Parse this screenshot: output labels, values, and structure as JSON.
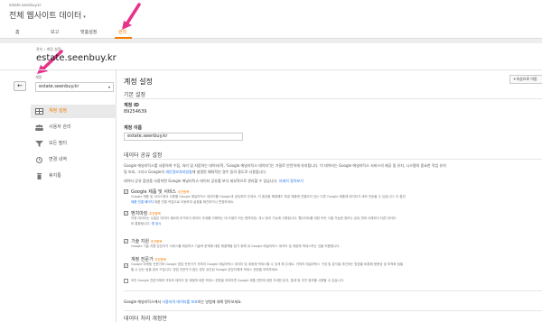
{
  "header": {
    "account_small": "estate.seenbuy.kr",
    "account_main": "전체 웹사이트 데이터",
    "tabs": [
      {
        "label": "홈"
      },
      {
        "label": "보고"
      },
      {
        "label": "맞춤설정"
      },
      {
        "label": "관리"
      }
    ],
    "active_tab": "관리"
  },
  "breadcrumb": "관리 › 계정 설정",
  "page_title": "estate.seenbuy.kr",
  "sidebar": {
    "account_label": "계정",
    "account_value": "estate.seenbuy.kr",
    "items": [
      {
        "label": "계정 설정",
        "icon": "settings-grid-icon",
        "active": true
      },
      {
        "label": "사용자 관리",
        "icon": "users-icon",
        "active": false
      },
      {
        "label": "모든 필터",
        "icon": "filter-icon",
        "active": false
      },
      {
        "label": "변경 내역",
        "icon": "history-icon",
        "active": false
      },
      {
        "label": "휴지통",
        "icon": "trash-icon",
        "active": false
      }
    ]
  },
  "main": {
    "section_title": "계정 설정",
    "property_button": "+속성으로 이동",
    "basic_settings": "기본 설정",
    "account_id_label": "계정 ID",
    "account_id_value": "89254639",
    "account_name_label": "계정 이름",
    "account_name_value": "estate.seenbuy.kr",
    "sharing_title": "데이터 공유 설정",
    "sharing_para1": "Google 애널리틱스를 사용하여 수집, 처리 및 저장하는 데이터(즉, 'Google 애널리틱스 데이터')는 기밀로 안전하게 유지됩니다. 이 데이터는 Google 애널리틱스 서비스의 제공 및 유지, 시스템의 중요한 작업 유지",
    "sharing_para1b": "및 보호, 그리고 Google의",
    "sharing_para1_link": "개인정보처리방침",
    "sharing_para1c": "에 설명된 예외적인 경우 등의 용도로 사용됩니다.",
    "sharing_para2": "데이터 공유 옵션을 사용하면 Google 애널리틱스 데이터 공유를 보다 세부적으로 관리할 수 있습니다.",
    "sharing_para2_link": "자세히 알아보기",
    "options": [
      {
        "title": "Google 제품 및 서비스",
        "rec": "추천항목",
        "checked": true,
        "desc1": "Google 제품 및 서비스에서 사용할 Google 애널리틱스 데이터를 Google과 공유하여 주세요. 이 옵션을 해제해도 특정 제품에 연결되어 있는 다른 Google 제품에 데이터가 계속 전송될 수 있습니다. 이 옵션",
        "desc2": "제품 연결 작업으로 이동하여 설정을 확인하거나 변경하세요.",
        "desc2_link": "제품 연결 페이지"
      },
      {
        "title": "벤치마킹",
        "rec": "추천항목",
        "checked": true,
        "desc1": "익명 데이터는 수많은 데이터 세트에 추가되어 데이터 추세를 이해하는 데 도움이 되는 벤치마킹, 게시 등의 기능에 사용됩니다. 웹사이트를 대한 모든 식별 가능한 정보는 공유 전에 삭제되어 다른 데이터",
        "desc2": "와 통합됩니다.",
        "desc2_link": "예 표시"
      },
      {
        "title": "기술 지원",
        "rec": "추천항목",
        "checked": true,
        "desc1": "Google 기술 지원 담당자가 서비스를 제공하고 기술적 문제에 대한 해결책을 찾기 위해 내 Google 애널리틱스 데이터 및 계정에 액세스하는 것을 허용합니다.",
        "desc2": "",
        "desc2_link": ""
      },
      {
        "title": "계정 전문가",
        "rec": "추천항목",
        "checked": true,
        "desc1": "Google 마케팅 전문가와 Google 영업 전문가가 귀하의 Google 애널리틱스 데이터 및 계정에 액세스할 수 있게 해 주세요. 귀하의 애널리틱스 구성 및 분석을 개선하는 방법을 비롯해 응용성 및 최적화 팁을",
        "desc2": "할 수 있는 팁을 찾아 드립니다. 영업 전문가가 없는 경우 승인된 Google 담당자에게 액세스 권한을 부여하세요.",
        "desc2_link": ""
      }
    ],
    "extra_option": "모든 Google 전문가에게 귀하의 데이터 및 계정에 대한 액세스 권한을 부여하면 Google 제품 전반에 대한 자세한 분석, 통계 및 추천 정보를 사용할 수 있습니다.",
    "footer_text": "Google 애널리틱스에서",
    "footer_link": "사용자의 데이터를 보호",
    "footer_text2": "하는 방법에 대해 알아보세요.",
    "processing_title": "데이터 처리 개정안"
  }
}
